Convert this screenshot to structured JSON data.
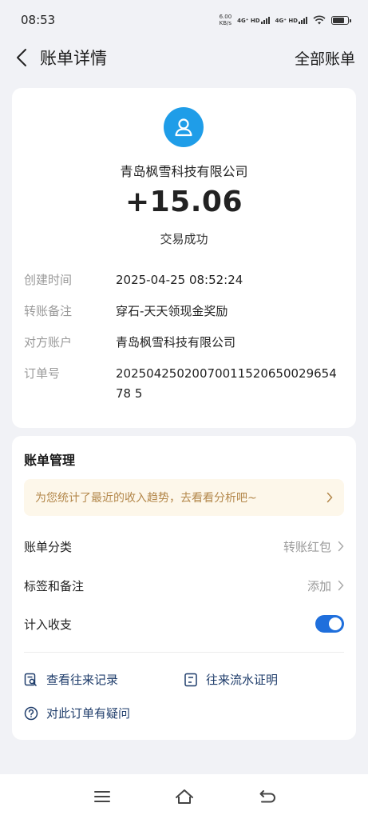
{
  "status_bar": {
    "time": "08:53",
    "net_speed_value": "6.00",
    "net_speed_unit": "KB/s",
    "signal1": "4G⁺ HD",
    "signal2": "4G⁺ HD"
  },
  "nav": {
    "title": "账单详情",
    "right_action": "全部账单"
  },
  "bill": {
    "payee": "青岛枫雪科技有限公司",
    "amount": "+15.06",
    "status": "交易成功",
    "details": [
      {
        "label": "创建时间",
        "value": "2025-04-25 08:52:24"
      },
      {
        "label": "转账备注",
        "value": "穿石-天天领现金奖励"
      },
      {
        "label": "对方账户",
        "value": "青岛枫雪科技有限公司"
      },
      {
        "label": "订单号",
        "value": "2025042502007001152065002965478 5"
      }
    ]
  },
  "management": {
    "title": "账单管理",
    "banner": "为您统计了最近的收入趋势，去看看分析吧~",
    "category_label": "账单分类",
    "category_value": "转账红包",
    "tags_label": "标签和备注",
    "tags_value": "添加",
    "count_label": "计入收支",
    "count_enabled": true,
    "links": {
      "history": "查看往来记录",
      "proof": "往来流水证明",
      "question": "对此订单有疑问"
    }
  },
  "colors": {
    "accent": "#1f6fdc",
    "avatar_bg": "#1f9de8",
    "banner_bg": "#fdf7ea",
    "banner_text": "#b3874a",
    "link_text": "#1f3d6b"
  }
}
